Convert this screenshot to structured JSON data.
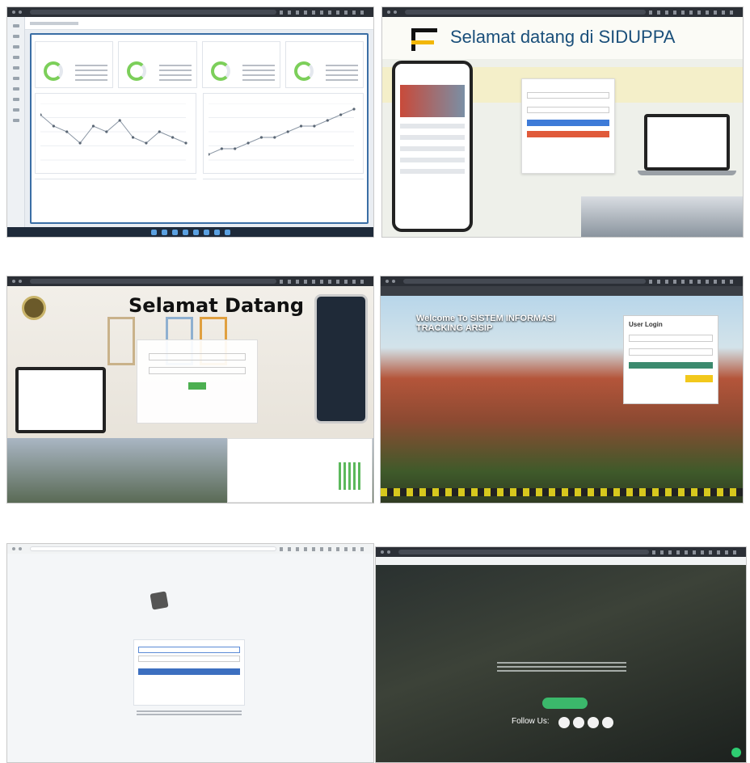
{
  "tiles": {
    "siduppa": {
      "title": "Selamat datang di SIDUPPA"
    },
    "selamat": {
      "title": "Selamat Datang"
    },
    "arsip": {
      "heading": "Welcome To SISTEM INFORMASI TRACKING ARSIP",
      "box_title": "User Login"
    },
    "sipunda": {
      "follow": "Follow Us:"
    }
  },
  "colors": {
    "dashboard_border": "#3a6ea5",
    "login_button_blue": "#3e7bd8",
    "login_button_red": "#e05a3a",
    "green_cta": "#3bb86b",
    "yellow": "#f2c81c"
  },
  "chart_data": [
    {
      "type": "line",
      "series": [
        {
          "values": [
            8,
            6,
            5,
            3,
            6,
            5,
            7,
            4,
            3,
            5,
            4,
            3
          ]
        }
      ]
    },
    {
      "type": "line",
      "series": [
        {
          "values": [
            1,
            2,
            2,
            3,
            4,
            4,
            5,
            6,
            6,
            7,
            8,
            9
          ]
        }
      ]
    }
  ]
}
